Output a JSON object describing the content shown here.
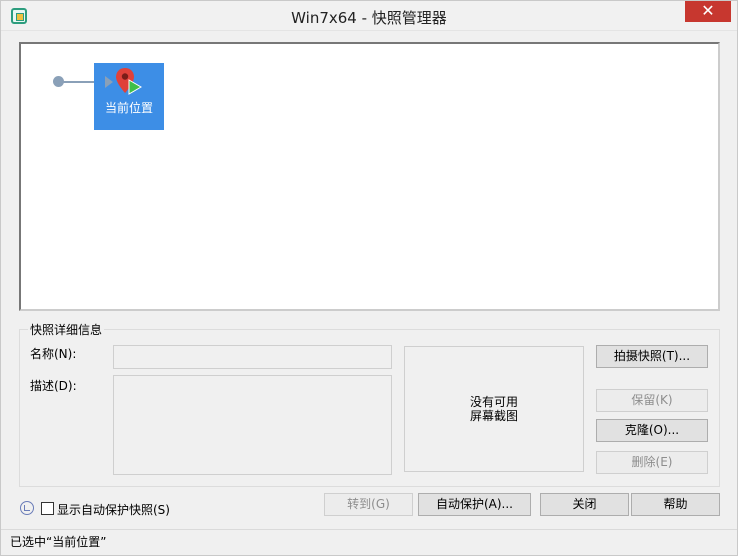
{
  "window": {
    "title": "Win7x64 - 快照管理器",
    "close_glyph": "✕"
  },
  "tree": {
    "nodes": [
      {
        "label": "当前位置",
        "icon": "location-pin-play-icon",
        "color": "#3d8ee6"
      }
    ]
  },
  "details": {
    "group_title": "快照详细信息",
    "name_label": "名称(N):",
    "name_value": "",
    "description_label": "描述(D):",
    "description_value": "",
    "screenshot_text": "没有可用\n屏幕截图"
  },
  "buttons": {
    "take_snapshot": "拍摄快照(T)...",
    "keep": "保留(K)",
    "clone": "克隆(O)...",
    "delete": "删除(E)",
    "goto": "转到(G)",
    "autoprotect": "自动保护(A)...",
    "close": "关闭",
    "help": "帮助"
  },
  "options": {
    "show_autoprotect_label": "显示自动保护快照(S)",
    "show_autoprotect_checked": false
  },
  "status": {
    "text": "已选中“当前位置”"
  },
  "colors": {
    "accent": "#3d8ee6",
    "close_button": "#c7372f"
  }
}
